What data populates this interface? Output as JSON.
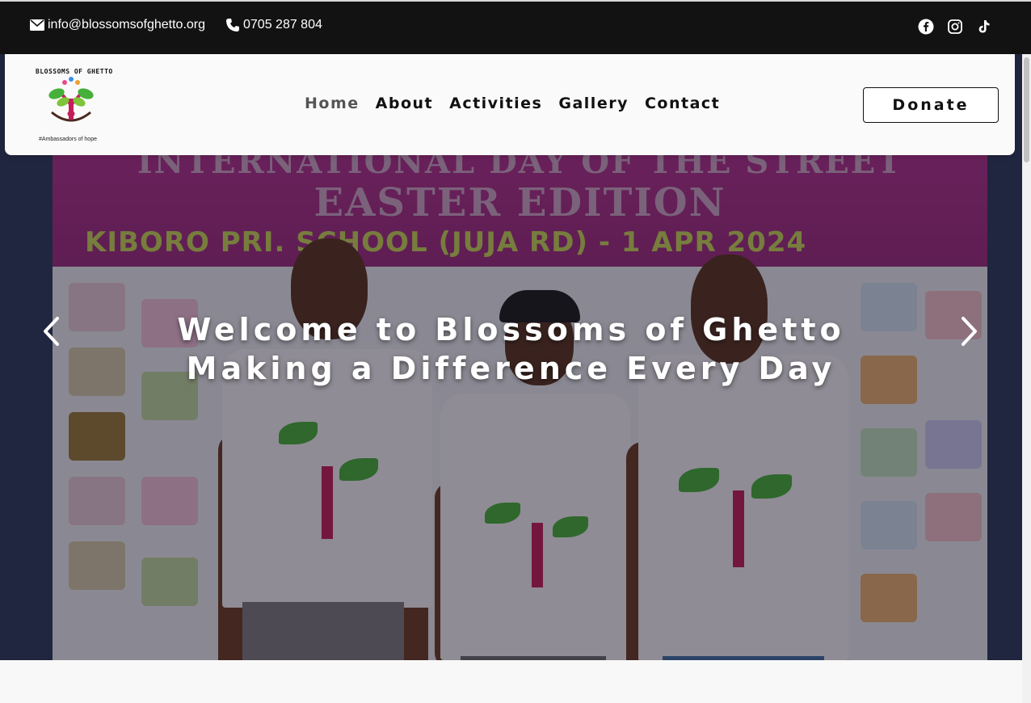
{
  "topbar": {
    "email": "info@blossomsofghetto.org",
    "phone": "0705 287 804",
    "social_icons": [
      "facebook-icon",
      "instagram-icon",
      "tiktok-icon"
    ]
  },
  "logo": {
    "title": "BLOSSOMS OF GHETTO",
    "tagline": "#Ambassadors of hope"
  },
  "nav": {
    "items": [
      {
        "label": "Home",
        "active": true
      },
      {
        "label": "About",
        "active": false
      },
      {
        "label": "Activities",
        "active": false
      },
      {
        "label": "Gallery",
        "active": false
      },
      {
        "label": "Contact",
        "active": false
      }
    ],
    "donate_label": "Donate"
  },
  "hero": {
    "title_line1": "Welcome to Blossoms of Ghetto",
    "title_line2": "Making a Difference Every Day",
    "banner_line1": "INTERNATIONAL DAY OF THE STREET",
    "banner_line2": "EASTER EDITION",
    "banner_line3": "KIBORO PRI. SCHOOL (JUJA RD) - 1 APR 2024"
  },
  "colors": {
    "topbar_bg": "#121212",
    "banner": "#b0308c",
    "leaf_green": "#46b03a",
    "trunk_pink": "#c41e5a"
  }
}
